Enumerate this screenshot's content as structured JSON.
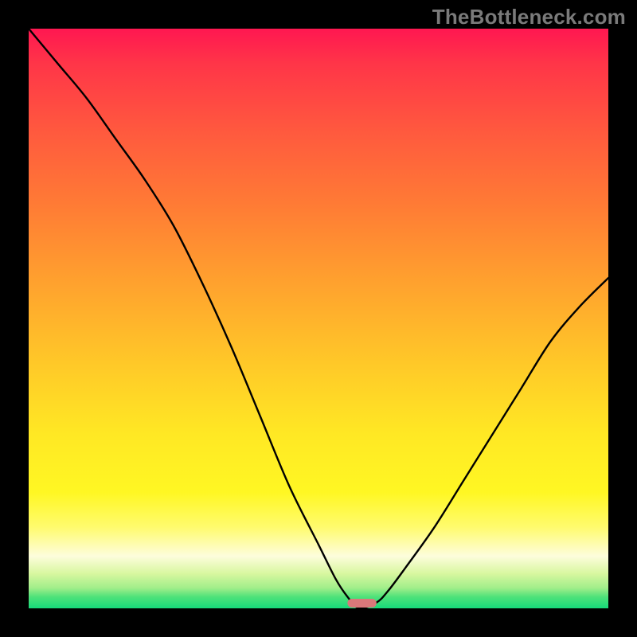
{
  "watermark": "TheBottleneck.com",
  "colors": {
    "page_bg": "#000000",
    "curve": "#000000",
    "marker": "#d9787a",
    "gradient_top": "#ff1751",
    "gradient_bottom": "#17d97a"
  },
  "chart_data": {
    "type": "line",
    "title": "",
    "xlabel": "",
    "ylabel": "",
    "xlim": [
      0,
      100
    ],
    "ylim": [
      0,
      100
    ],
    "grid": false,
    "legend": false,
    "notes": "Single curve on a vertical red-to-green gradient background; y near 0 (green) is optimal, y near 100 (red) is worst. The curve descends from top-left to a minimum near x≈57 then rises again toward the right. Values are visually estimated from the image.",
    "series": [
      {
        "name": "bottleneck-curve",
        "x": [
          0,
          5,
          10,
          15,
          20,
          25,
          30,
          35,
          40,
          45,
          50,
          53,
          55,
          57,
          60,
          62,
          65,
          70,
          75,
          80,
          85,
          90,
          95,
          100
        ],
        "values": [
          100,
          94,
          88,
          81,
          74,
          66,
          56,
          45,
          33,
          21,
          11,
          5,
          2,
          0,
          1,
          3,
          7,
          14,
          22,
          30,
          38,
          46,
          52,
          57
        ]
      }
    ],
    "marker": {
      "x_start": 55,
      "x_end": 60,
      "y": 0.9,
      "description": "short horizontal rounded bar at the curve minimum near the baseline"
    }
  }
}
